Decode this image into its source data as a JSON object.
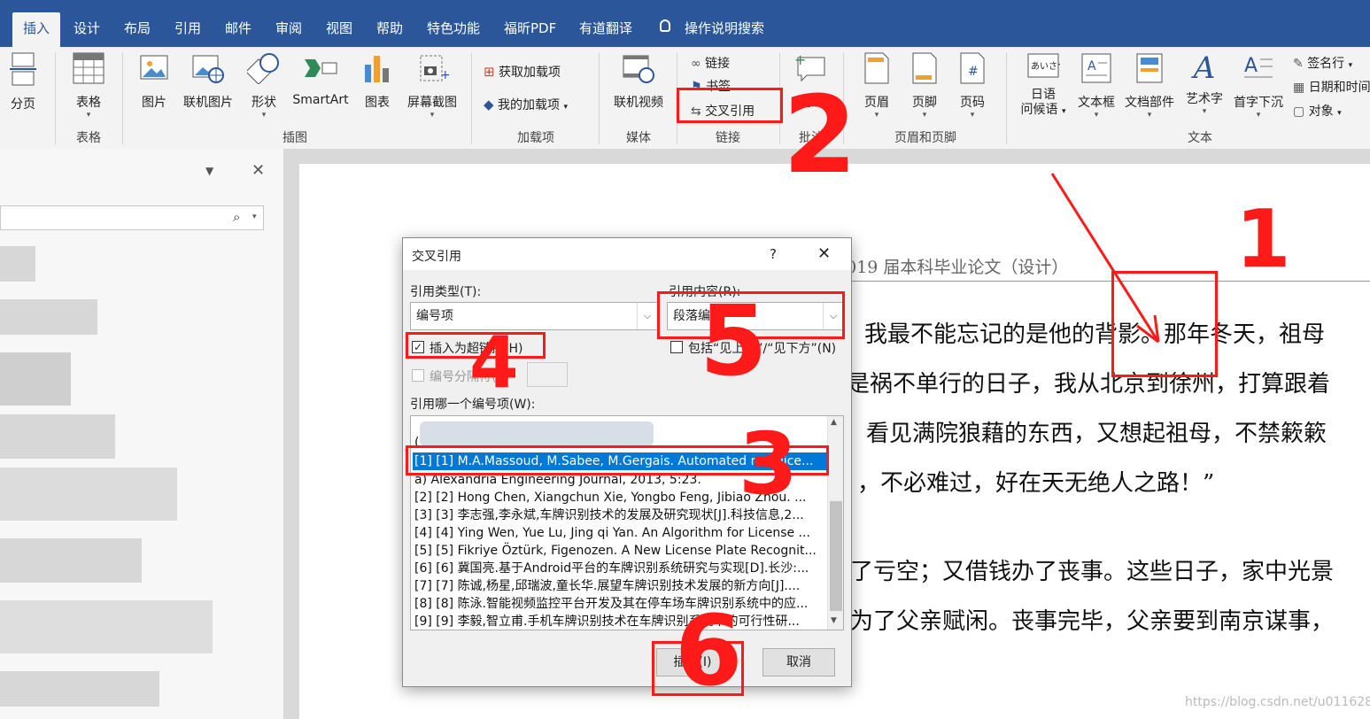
{
  "tabs": [
    "插入",
    "设计",
    "布局",
    "引用",
    "邮件",
    "审阅",
    "视图",
    "帮助",
    "特色功能",
    "福昕PDF",
    "有道翻译",
    "操作说明搜索"
  ],
  "ribbon": {
    "page_break": "分页",
    "table": "表格",
    "group_table": "表格",
    "picture": "图片",
    "online_picture": "联机图片",
    "shapes": "形状",
    "smartart": "SmartArt",
    "chart": "图表",
    "screenshot": "屏幕截图",
    "group_illustrations": "插图",
    "get_addins": "获取加载项",
    "my_addins": "我的加载项",
    "group_addins": "加载项",
    "online_video": "联机视频",
    "group_media": "媒体",
    "link": "链接",
    "bookmark": "书签",
    "cross_reference": "交叉引用",
    "group_links": "链接",
    "comment": "批注",
    "group_comments": "批注",
    "header": "页眉",
    "footer": "页脚",
    "page_number": "页码",
    "group_header_footer": "页眉和页脚",
    "japanese": "日语\n问候语",
    "japanese_l1": "日语",
    "japanese_l2": "问候语",
    "textbox": "文本框",
    "quickparts": "文档部件",
    "wordart": "艺术字",
    "dropcap": "首字下沉",
    "signature": "签名行",
    "datetime": "日期和时间",
    "object": "对象",
    "group_text": "文本"
  },
  "document": {
    "header_line": "届 2019 届本科毕业论文（设计）",
    "lines": [
      "我最不能忘记的是他的背影。那年冬天，祖母",
      "是祸不单行的日子，我从北京到徐州，打算跟着",
      "看见满院狼藉的东西，又想起祖母，不禁簌簌",
      "，不必难过，好在天无绝人之路！”",
      "了亏空；又借钱办了丧事。这些日子，家中光景",
      "为了父亲赋闲。丧事完毕，父亲要到南京谋事，"
    ],
    "watermark": "https://blog.csdn.net/u011628794"
  },
  "dialog": {
    "title": "交叉引用",
    "help": "?",
    "ref_type_label": "引用类型(T):",
    "ref_type_value": "编号项",
    "ref_content_label": "引用内容(R):",
    "ref_content_value": "段落编号",
    "insert_hyperlink": "插入为超链接(H)",
    "include_above_below": "包括“见上方”/“见下方”(N)",
    "separator_label": "编号分隔符(S)",
    "which_item_label": "引用哪一个编号项(W):",
    "items": [
      "(",
      "[1] [1] M.A.Massoud, M.Sabee, M.Gergais. Automated new lice...",
      "a) Alexandria Engineering Journal, 2013, 5:23.",
      "[2] [2] Hong Chen, Xiangchun Xie, Yongbo Feng, Jibiao Zhou. ...",
      "[3] [3] 李志强,李永斌,车牌识别技术的发展及研究现状[J].科技信息,2...",
      "[4] [4] Ying Wen, Yue Lu, Jing qi Yan. An Algorithm for License ...",
      "[5] [5] Fikriye Öztürk, Figenozen. A New License Plate Recognit...",
      "[6] [6] 冀国亮.基于Android平台的车牌识别系统研究与实现[D].长沙:...",
      "[7] [7] 陈诚,杨星,邱瑞波,童长华.展望车牌识别技术发展的新方向[J]....",
      "[8] [8] 陈泳.智能视频监控平台开发及其在停车场车牌识别系统中的应...",
      "[9] [9] 李毅,智立甫.手机车牌识别技术在车牌识别系统中的可行性研..."
    ],
    "insert_button": "插入(I)",
    "cancel_button": "取消"
  },
  "annotations": [
    "1",
    "2",
    "3",
    "4",
    "5",
    "6"
  ],
  "colors": {
    "ribbon_blue": "#2b579a",
    "highlight": "#0078d7",
    "annotation_red": "#ff1a1a"
  }
}
